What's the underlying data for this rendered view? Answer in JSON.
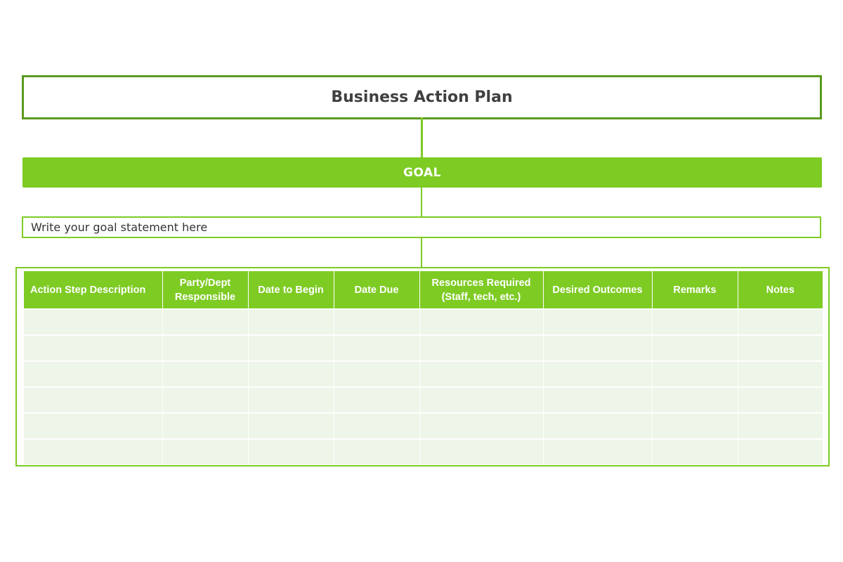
{
  "title": "Business Action Plan",
  "goal_label": "GOAL",
  "goal_statement": "Write your goal statement here",
  "table": {
    "headers": [
      "Action Step Description",
      "Party/Dept\nResponsible",
      "Date to Begin",
      "Date Due",
      "Resources Required\n(Staff, tech, etc.)",
      "Desired Outcomes",
      "Remarks",
      "Notes"
    ],
    "rows": [
      [
        "",
        "",
        "",
        "",
        "",
        "",
        "",
        ""
      ],
      [
        "",
        "",
        "",
        "",
        "",
        "",
        "",
        ""
      ],
      [
        "",
        "",
        "",
        "",
        "",
        "",
        "",
        ""
      ],
      [
        "",
        "",
        "",
        "",
        "",
        "",
        "",
        ""
      ],
      [
        "",
        "",
        "",
        "",
        "",
        "",
        "",
        ""
      ],
      [
        "",
        "",
        "",
        "",
        "",
        "",
        "",
        ""
      ]
    ]
  },
  "colors": {
    "title_border": "#5a9a1f",
    "accent_green": "#7ecb24",
    "cell_fill": "#eef5e9",
    "title_text": "#404040"
  }
}
